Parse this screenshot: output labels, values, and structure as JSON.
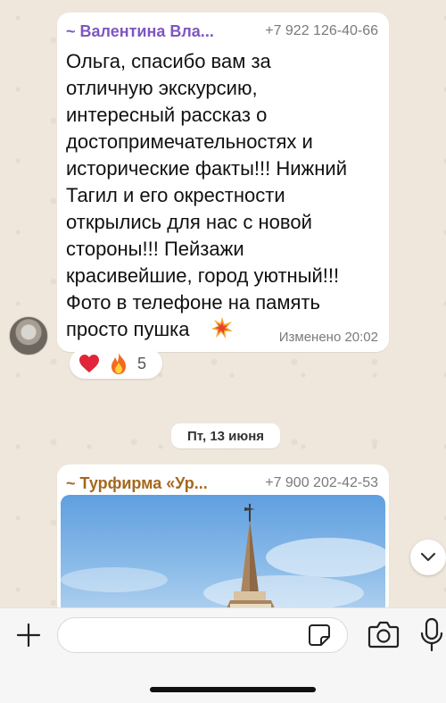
{
  "message1": {
    "sender": "~ Валентина Вла...",
    "phone": "+7 922 126-40-66",
    "text": "Ольга, спасибо вам за\nотличную экскурсию,\nинтересный рассказ о\nдостопримечательностях и\nисторические факты!!! Нижний\nТагил и его окрестности\nоткрылись для нас с новой\nстороны!!! Пейзажи\nкрасивейшие, город уютный!!!\nФото в телефоне на память\nпросто пушка",
    "meta": "Изменено 20:02",
    "reactions": {
      "icons": [
        "heart-icon",
        "fire-icon"
      ],
      "count": "5"
    }
  },
  "date_separator": "Пт, 13 июня",
  "message2": {
    "sender": "~ Турфирма «Ур...",
    "phone": "+7 900 202-42-53"
  },
  "input": {
    "placeholder": ""
  },
  "colors": {
    "sender1": "#7d57c1",
    "sender2": "#a4681d",
    "chat_bg": "#efe7dc"
  }
}
